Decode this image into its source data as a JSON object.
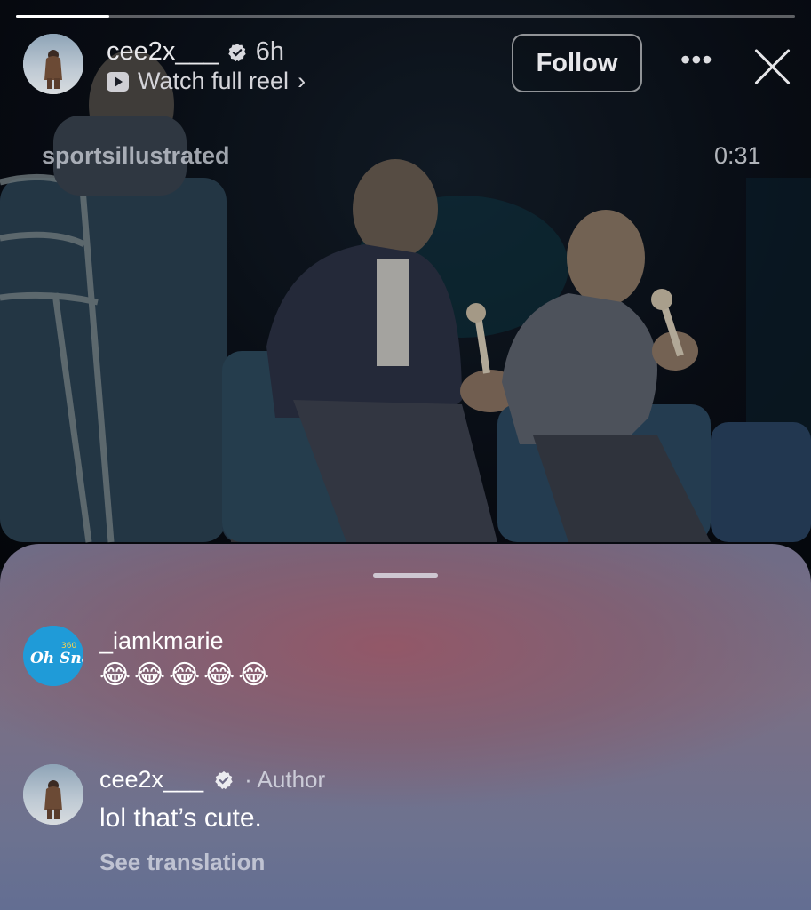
{
  "story": {
    "progress": 0.12,
    "username": "cee2x___",
    "time": "6h",
    "watch_label": "Watch full reel",
    "watch_chevron": "›",
    "follow_label": "Follow",
    "more_label": "•••",
    "watermark": "sportsillustrated",
    "duration": "0:31"
  },
  "icons": [
    "verified-badge-icon",
    "play-icon",
    "more-icon",
    "close-icon"
  ],
  "comments": [
    {
      "username": "_iamkmarie",
      "text": "😂😂😂😂😂",
      "avatar_text": "Oh Snap",
      "avatar_superscript": "360"
    },
    {
      "username": "cee2x___",
      "author_label": "· Author",
      "text": "lol that’s cute.",
      "translation_label": "See translation"
    }
  ],
  "colors": {
    "sheet_top": "#94566a",
    "sheet_bottom": "#636e92",
    "ohsnap_avatar": "#1f9bd8"
  }
}
